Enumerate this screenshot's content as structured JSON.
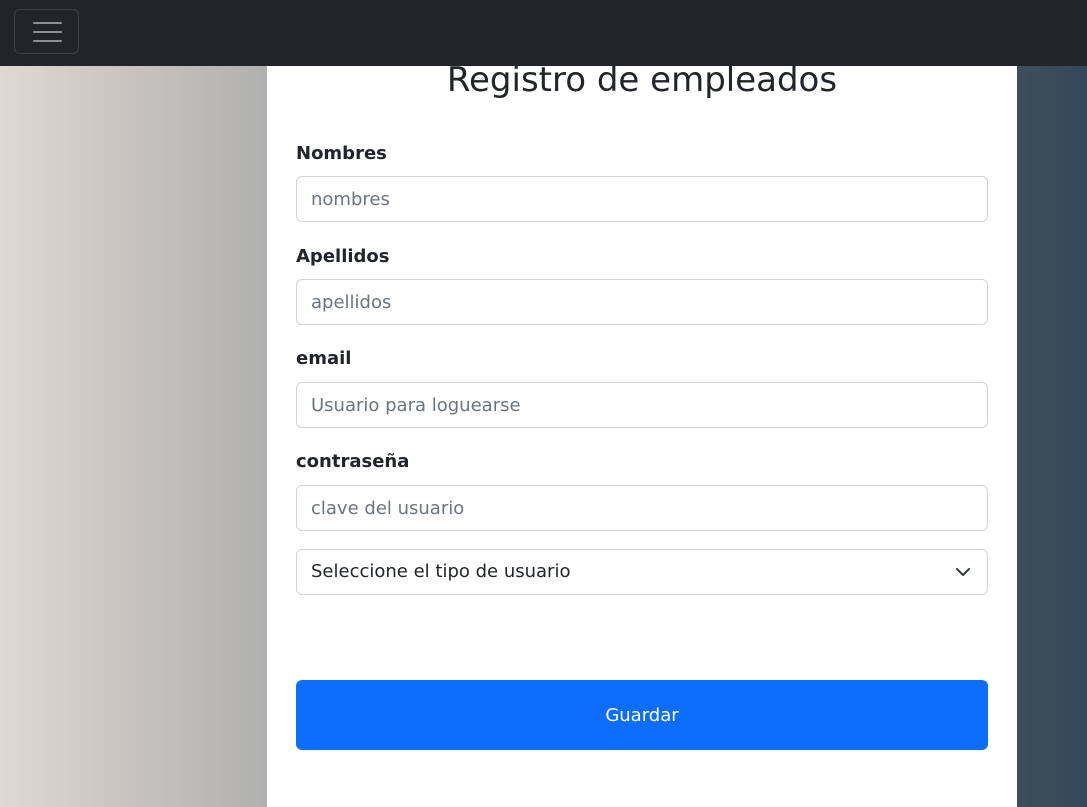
{
  "navbar": {
    "toggler_icon": "hamburger-icon"
  },
  "form": {
    "title": "Registro de empleados",
    "fields": [
      {
        "label": "Nombres",
        "placeholder": "nombres"
      },
      {
        "label": "Apellidos",
        "placeholder": "apellidos"
      },
      {
        "label": "email",
        "placeholder": "Usuario para loguearse"
      },
      {
        "label": "contraseña",
        "placeholder": "clave del usuario"
      }
    ],
    "user_type_select": {
      "selected": "Seleccione el tipo de usuario",
      "icon": "chevron-down-icon"
    },
    "submit_label": "Guardar"
  },
  "colors": {
    "navbar_bg": "#212529",
    "primary": "#0d6efd",
    "text": "#212529",
    "placeholder": "#6c757d",
    "border": "#ced4da"
  }
}
